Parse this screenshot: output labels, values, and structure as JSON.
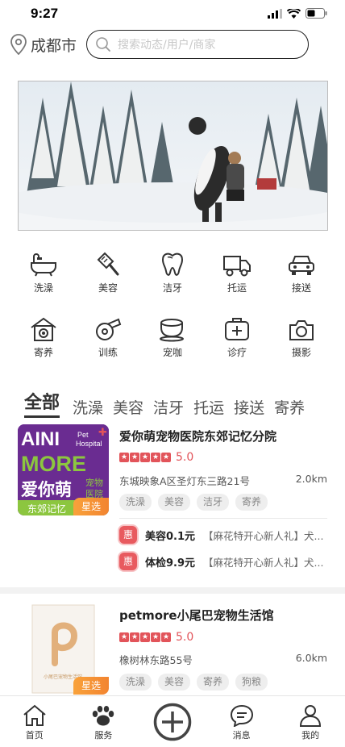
{
  "status_bar": {
    "time": "9:27"
  },
  "header": {
    "city": "成都市",
    "search_placeholder": "搜索动态/用户/商家"
  },
  "categories": [
    {
      "label": "洗澡",
      "icon": "bathtub-icon"
    },
    {
      "label": "美容",
      "icon": "grooming-icon"
    },
    {
      "label": "洁牙",
      "icon": "tooth-icon"
    },
    {
      "label": "托运",
      "icon": "truck-icon"
    },
    {
      "label": "接送",
      "icon": "car-icon"
    },
    {
      "label": "寄养",
      "icon": "pet-house-icon"
    },
    {
      "label": "训练",
      "icon": "whistle-icon"
    },
    {
      "label": "宠咖",
      "icon": "coffee-icon"
    },
    {
      "label": "诊疗",
      "icon": "medical-kit-icon"
    },
    {
      "label": "摄影",
      "icon": "camera-icon"
    }
  ],
  "tabs": [
    "全部",
    "洗澡",
    "美容",
    "洁牙",
    "托运",
    "接送",
    "寄养"
  ],
  "stores": [
    {
      "name": "爱你萌宠物医院东郊记忆分院",
      "rating": "5.0",
      "address": "东城映象A区圣灯东三路21号",
      "distance": "2.0km",
      "tags": [
        "洗澡",
        "美容",
        "洁牙",
        "寄养"
      ],
      "badge": "星选",
      "logo": {
        "line1": "AINI",
        "line2": "MORE",
        "cn": "爱你萌",
        "pet": "Pet",
        "hospital": "Hospital",
        "pet_cn": "宠物",
        "hospital_cn": "医院",
        "branch": "东郊记忆"
      },
      "promos": [
        {
          "tag": "惠",
          "price": "美容0.1元",
          "desc": "【麻花特开心新人礼】犬..."
        },
        {
          "tag": "惠",
          "price": "体检9.9元",
          "desc": "【麻花特开心新人礼】犬..."
        }
      ]
    },
    {
      "name": "petmore小尾巴宠物生活馆",
      "rating": "5.0",
      "address": "橡树林东路55号",
      "distance": "6.0km",
      "tags": [
        "洗澡",
        "美容",
        "寄养",
        "狗粮"
      ],
      "badge": "星选",
      "logo": {
        "text": "小尾巴宠物生活馆"
      }
    }
  ],
  "bottom_nav": [
    {
      "label": "首页",
      "icon": "home-icon"
    },
    {
      "label": "服务",
      "icon": "paw-icon"
    },
    {
      "label": "",
      "icon": "add-icon"
    },
    {
      "label": "消息",
      "icon": "message-icon"
    },
    {
      "label": "我的",
      "icon": "user-icon"
    }
  ],
  "colors": {
    "accent_red": "#e2545a",
    "badge_orange": "#f28430",
    "logo_purple": "#6a2c91",
    "logo_green": "#8cc63f"
  }
}
